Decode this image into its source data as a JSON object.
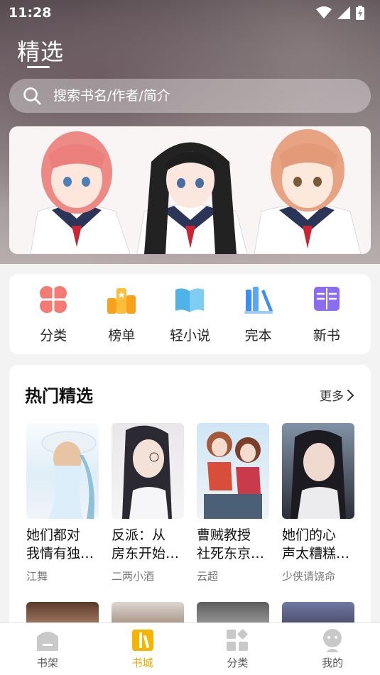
{
  "status": {
    "time": "11:28"
  },
  "header": {
    "title": "精选"
  },
  "search": {
    "placeholder": "搜索书名/作者/简介"
  },
  "quick_nav": [
    {
      "label": "分类",
      "icon": "category-icon"
    },
    {
      "label": "榜单",
      "icon": "ranking-icon"
    },
    {
      "label": "轻小说",
      "icon": "light-novel-icon"
    },
    {
      "label": "完本",
      "icon": "completed-icon"
    },
    {
      "label": "新书",
      "icon": "new-book-icon"
    }
  ],
  "hot": {
    "title": "热门精选",
    "more": "更多",
    "books": [
      {
        "title": "她们都对\n我情有独…",
        "author": "江舞"
      },
      {
        "title": "反派：从\n房东开始…",
        "author": "二两小酒"
      },
      {
        "title": "曹贼教授\n社死东京…",
        "author": "云超"
      },
      {
        "title": "她们的心\n声太糟糕…",
        "author": "少侠请饶命"
      }
    ]
  },
  "tabbar": {
    "items": [
      {
        "label": "书架"
      },
      {
        "label": "书城"
      },
      {
        "label": "分类"
      },
      {
        "label": "我的"
      }
    ],
    "active_color": "#f2a900"
  }
}
